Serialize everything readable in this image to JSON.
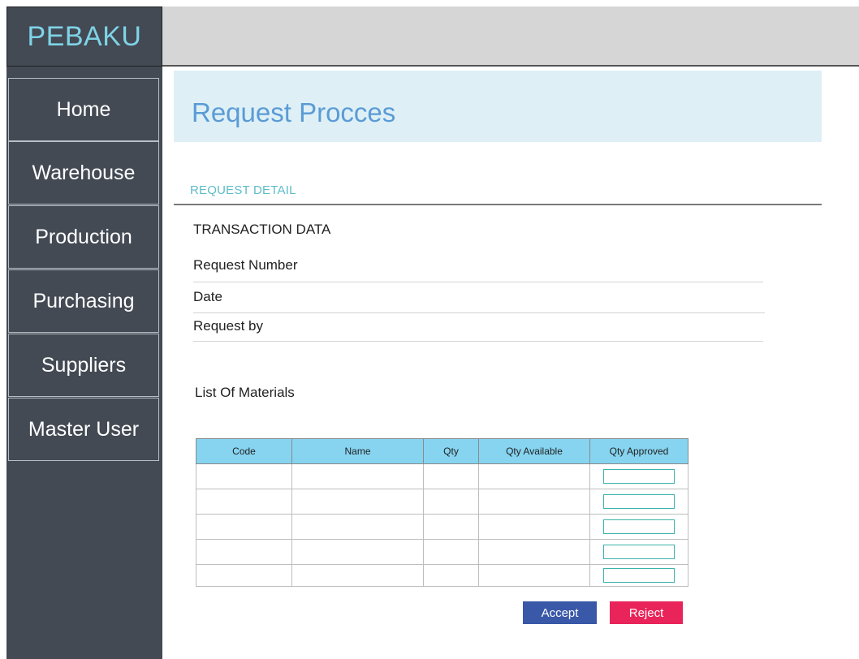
{
  "app": {
    "logo": "PEBAKU"
  },
  "sidebar": {
    "items": [
      {
        "label": "Home"
      },
      {
        "label": "Warehouse"
      },
      {
        "label": "Production"
      },
      {
        "label": "Purchasing"
      },
      {
        "label": "Suppliers"
      },
      {
        "label": "Master User"
      }
    ]
  },
  "main": {
    "title": "Request Procces",
    "section_title": "REQUEST DETAIL",
    "transaction": {
      "heading": "TRANSACTION DATA",
      "request_number_label": "Request Number",
      "date_label": "Date",
      "request_by_label": "Request by"
    },
    "materials": {
      "heading": "List Of Materials",
      "columns": [
        "Code",
        "Name",
        "Qty",
        "Qty Available",
        "Qty Approved"
      ]
    },
    "buttons": {
      "accept": "Accept",
      "reject": "Reject"
    }
  },
  "colors": {
    "sidebar": "#434a54",
    "logo_text": "#7fd3e6",
    "title_band": "#def0f6",
    "title_text": "#5b9bd5",
    "table_header": "#86d4f0",
    "accept": "#3a58a8",
    "reject": "#e9245a"
  }
}
